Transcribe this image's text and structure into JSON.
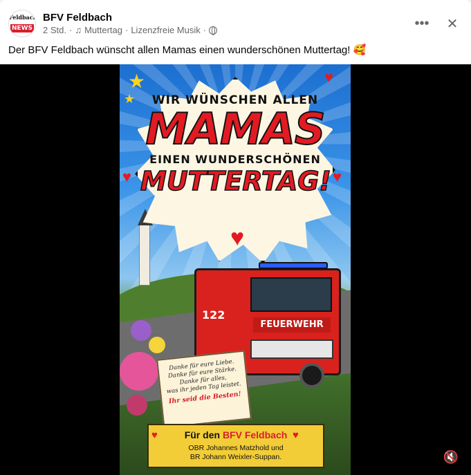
{
  "post": {
    "page_name": "BFV Feldbach",
    "avatar": {
      "top_text": "Feldbach",
      "bar_text": "NEWS",
      "accent": "#d81e2c"
    },
    "time": "2 Std.",
    "separator": "·",
    "music_icon": "♫",
    "audio_label": "Muttertag",
    "audio_source": "Lizenzfreie Musik",
    "privacy_icon": "globe-icon",
    "caption": "Der BFV Feldbach wünscht allen Mamas einen wunderschönen Muttertag! 🥰"
  },
  "actions": {
    "more_icon": "•••",
    "close_icon": "✕"
  },
  "poster": {
    "line1": "WIR WÜNSCHEN ALLEN",
    "line2": "MAMAS",
    "line3": "EINEN WUNDERSCHÖNEN",
    "line4": "MUTTERTAG!",
    "truck_number": "122",
    "truck_label": "FEUERWEHR",
    "note_lines": [
      "Danke für eure Liebe.",
      "Danke für eure Stärke.",
      "Danke für alles,",
      "was ihr jeden Tag leistet."
    ],
    "note_closing": "Ihr seid die Besten!",
    "banner_prefix": "Für den ",
    "banner_highlight": "BFV Feldbach",
    "banner_line2": "OBR Johannes Matzhold und",
    "banner_line3": "BR Johann Weixler-Suppan."
  },
  "media_controls": {
    "mute_icon": "🔇"
  }
}
